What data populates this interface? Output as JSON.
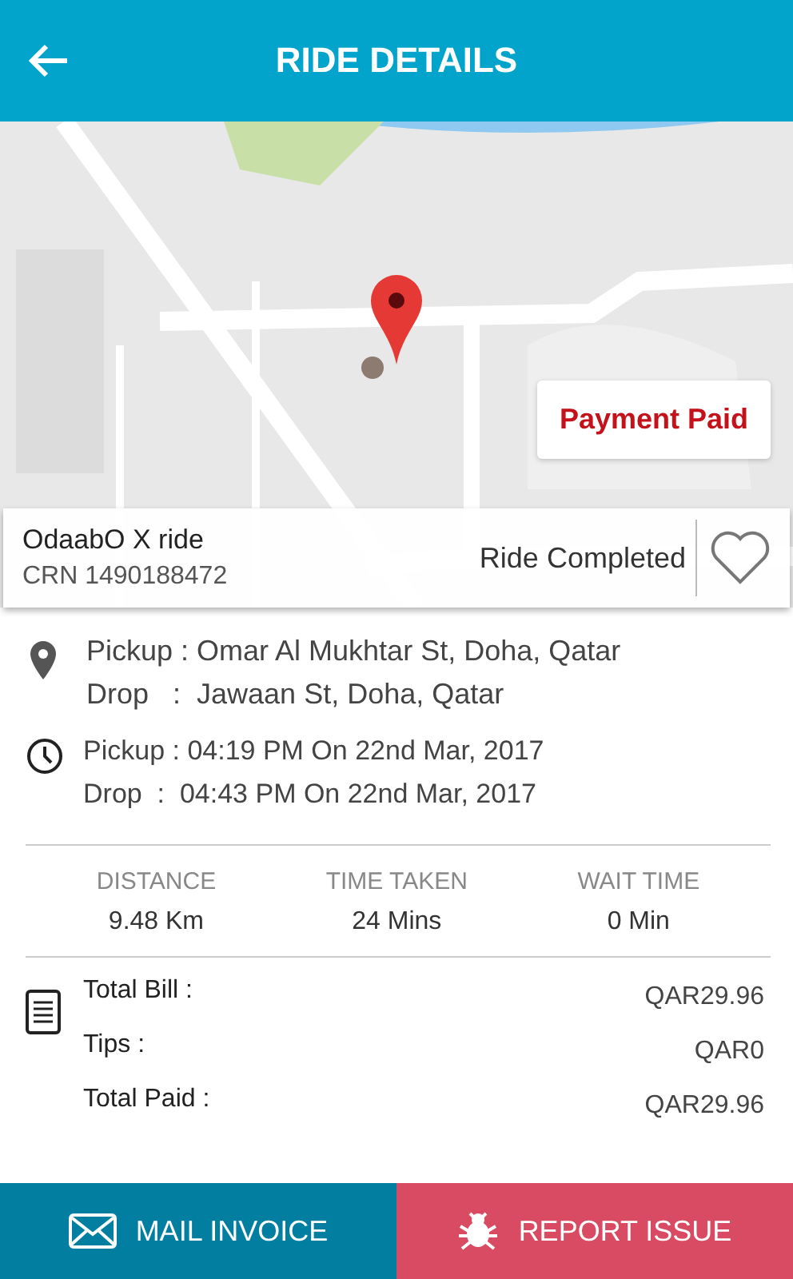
{
  "header": {
    "title": "RIDE DETAILS"
  },
  "map": {
    "payment_status": "Payment Paid"
  },
  "ride": {
    "name": "OdaabO X ride",
    "crn": "CRN 1490188472",
    "status": "Ride Completed",
    "favorite": false
  },
  "locations": {
    "pickup": "Pickup : Omar Al Mukhtar St, Doha, Qatar",
    "drop": "Drop   :  Jawaan St, Doha, Qatar"
  },
  "times": {
    "pickup": "Pickup : 04:19 PM On 22nd Mar, 2017",
    "drop": "Drop  :  04:43 PM On 22nd Mar, 2017"
  },
  "stats": [
    {
      "label": "DISTANCE",
      "value": "9.48 Km"
    },
    {
      "label": "TIME TAKEN",
      "value": "24 Mins"
    },
    {
      "label": "WAIT TIME",
      "value": "0 Min"
    }
  ],
  "bill": [
    {
      "label": "Total Bill :",
      "amount": "QAR29.96"
    },
    {
      "label": "Tips :",
      "amount": "QAR0"
    },
    {
      "label": "Total Paid :",
      "amount": "QAR29.96"
    }
  ],
  "actions": [
    {
      "kind": "mail",
      "label": "MAIL INVOICE"
    },
    {
      "kind": "report",
      "label": "REPORT ISSUE"
    }
  ]
}
